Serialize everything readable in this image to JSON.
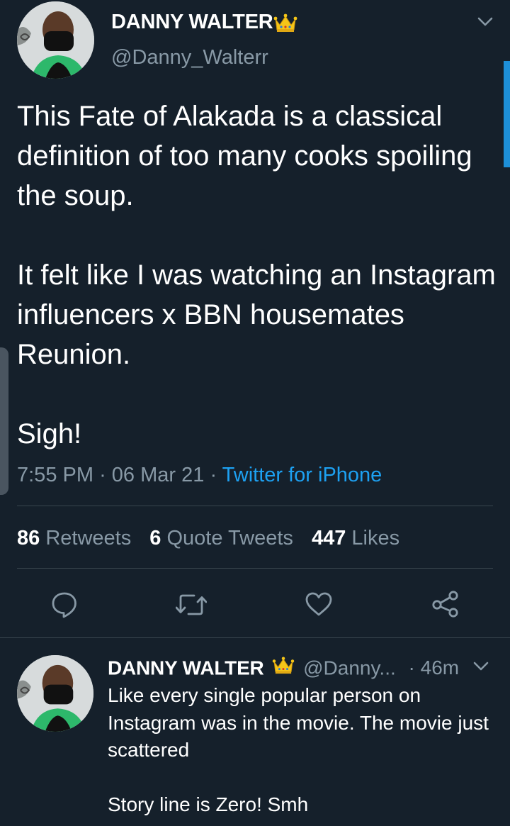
{
  "main_tweet": {
    "display_name": "DANNY WALTER",
    "handle": "@Danny_Walterr",
    "text": "This Fate of Alakada is a classical definition of too many cooks spoiling the soup.\n\nIt felt like I was watching an Instagram influencers x BBN housemates Reunion.\n\nSigh!",
    "time": "7:55 PM",
    "separator": "·",
    "date": "06 Mar 21",
    "source": "Twitter for iPhone"
  },
  "stats": {
    "retweets_count": "86",
    "retweets_label": "Retweets",
    "quotes_count": "6",
    "quotes_label": "Quote Tweets",
    "likes_count": "447",
    "likes_label": "Likes"
  },
  "actions": {
    "icons": [
      "reply-icon",
      "retweet-icon",
      "like-icon",
      "share-icon"
    ]
  },
  "reply": {
    "display_name": "DANNY WALTER",
    "handle": "@Danny...",
    "time": "· 46m",
    "text": "Like every single popular person on Instagram was in the movie. The movie just scattered\n\nStory line is Zero! Smh"
  },
  "colors": {
    "background": "#15202b",
    "divider": "#38444d",
    "muted": "#8899a6",
    "link": "#1da1f2",
    "crown": "#f5c518"
  }
}
